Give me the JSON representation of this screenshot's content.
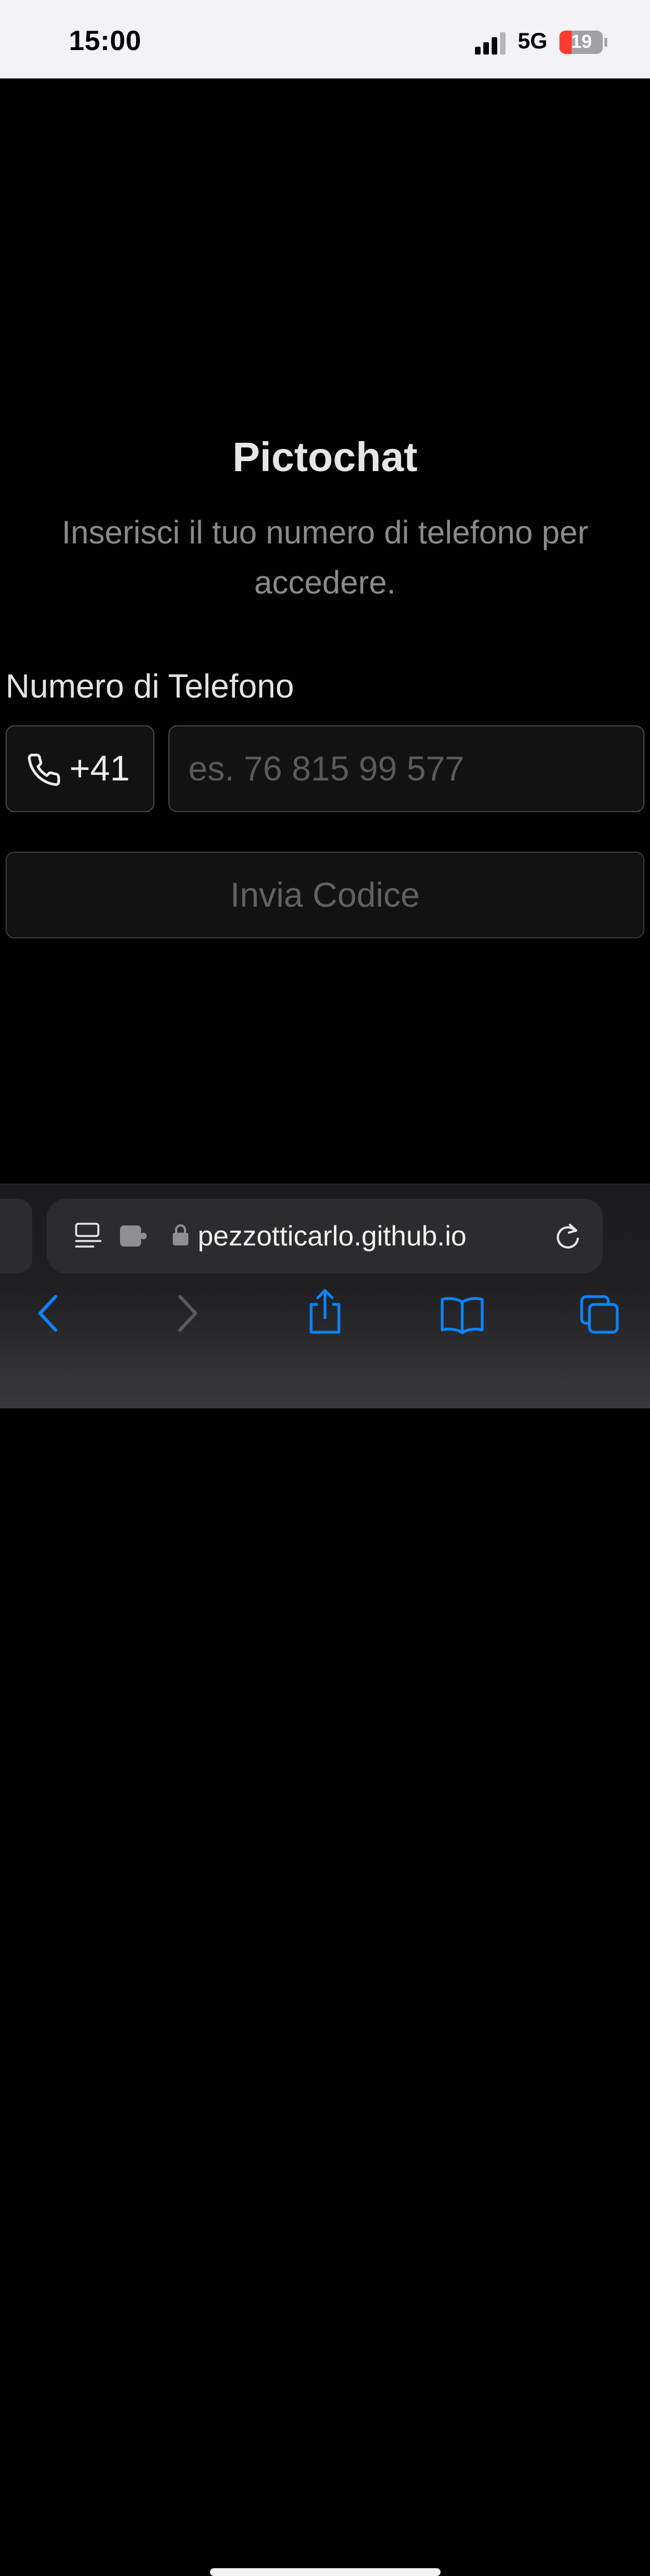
{
  "status_bar": {
    "time": "15:00",
    "network": "5G",
    "battery": "19",
    "icons": [
      "signal-icon",
      "battery-icon"
    ]
  },
  "app": {
    "title": "Pictochat",
    "subtitle": "Inserisci il tuo numero di telefono per accedere."
  },
  "form": {
    "phone_label": "Numero di Telefono",
    "country_prefix": "+41",
    "prefix_icon": "phone-icon",
    "number_value": "",
    "number_placeholder": "es. 76 815 99 577",
    "submit_label": "Invia Codice"
  },
  "browser": {
    "url": "pezzotticarlo.github.io",
    "address_icons": [
      "reader-icon",
      "extension-icon",
      "lock-icon",
      "reload-icon"
    ],
    "toolbar_icons": [
      "back-icon",
      "forward-icon",
      "share-icon",
      "bookmarks-icon",
      "tabs-icon"
    ]
  },
  "colors": {
    "background": "#000000",
    "accent": "#0a84ff",
    "status_bar_bg": "#f2f2f7",
    "battery_low": "#ff3b30"
  }
}
